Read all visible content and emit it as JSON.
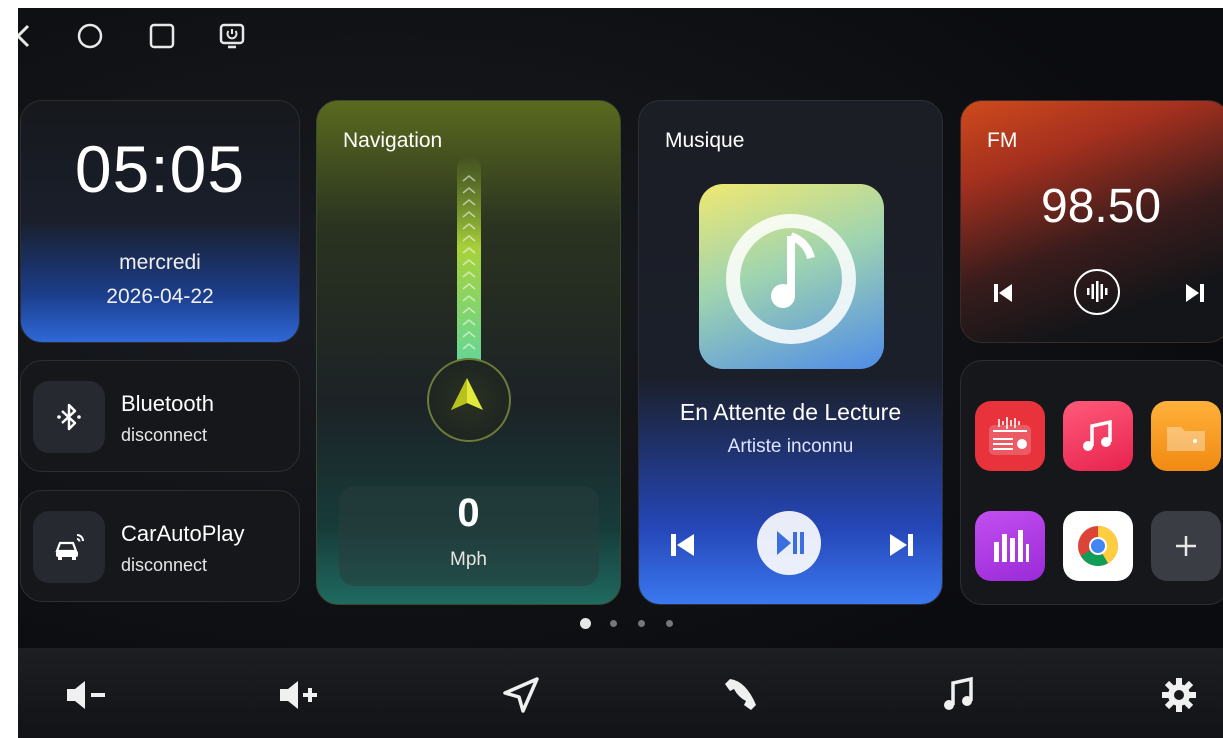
{
  "system_bar": {
    "icons": [
      "back-icon",
      "home-icon",
      "recents-icon",
      "screen-power-icon"
    ]
  },
  "clock": {
    "time": "05:05",
    "day": "mercredi",
    "date": "2026-04-22"
  },
  "connections": [
    {
      "name": "Bluetooth",
      "status": "disconnect",
      "icon": "bluetooth-icon"
    },
    {
      "name": "CarAutoPlay",
      "status": "disconnect",
      "icon": "car-play-icon"
    }
  ],
  "navigation": {
    "title": "Navigation",
    "speed": "0",
    "unit": "Mph"
  },
  "music": {
    "title": "Musique",
    "song": "En Attente de Lecture",
    "artist": "Artiste inconnu"
  },
  "fm": {
    "title": "FM",
    "frequency": "98.50"
  },
  "apps": [
    {
      "name": "radio-app",
      "color": "#e8323c"
    },
    {
      "name": "music-app",
      "color": "#f2345a"
    },
    {
      "name": "files-app",
      "color": "#f5a623"
    },
    {
      "name": "equalizer-app",
      "color": "#b43ee6"
    },
    {
      "name": "chrome-app",
      "color": "#ffffff"
    },
    {
      "name": "add-app",
      "color": "#3a3d44"
    }
  ],
  "page_indicator": {
    "count": 4,
    "active": 1
  },
  "bottom_bar": [
    "volume-down-icon",
    "volume-up-icon",
    "navigation-icon",
    "phone-icon",
    "music-icon",
    "settings-icon"
  ],
  "colors": {
    "accent_green": "#a7d13a",
    "accent_blue": "#3b78f0",
    "fm_orange": "#cf4a1c"
  }
}
